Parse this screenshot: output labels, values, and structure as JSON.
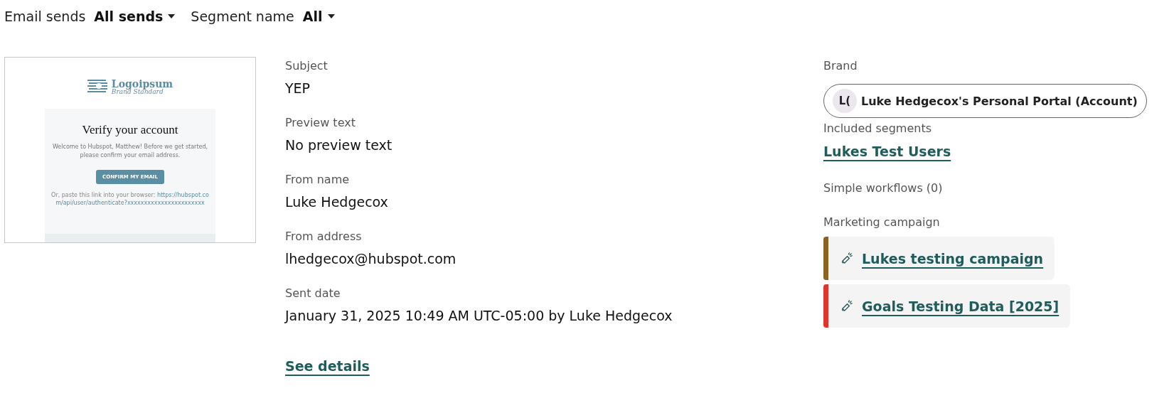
{
  "filters": [
    {
      "label": "Email sends",
      "value": "All sends"
    },
    {
      "label": "Segment name",
      "value": "All"
    }
  ],
  "preview": {
    "logo_name": "Logoipsum",
    "logo_tagline": "Brand Standard",
    "heading": "Verify your account",
    "body": "Welcome to Hubspot, Matthew! Before we get started, please confirm your email address.",
    "button": "CONFIRM MY EMAIL",
    "link_intro": "Or, paste this link into your browser:",
    "link": "https://hubspot.com/api/user/authenticate?xxxxxxxxxxxxxxxxxxxxxxx"
  },
  "details": [
    {
      "label": "Subject",
      "value": "YEP"
    },
    {
      "label": "Preview text",
      "value": "No preview text"
    },
    {
      "label": "From name",
      "value": "Luke Hedgecox"
    },
    {
      "label": "From address",
      "value": "lhedgecox@hubspot.com"
    },
    {
      "label": "Sent date",
      "value": "January 31, 2025 10:49 AM UTC-05:00 by Luke Hedgecox"
    }
  ],
  "see_details": "See details",
  "brand": {
    "label": "Brand",
    "initials": "L(",
    "name": "Luke Hedgecox's Personal Portal (Account)"
  },
  "segments": {
    "label": "Included segments",
    "items": [
      "Lukes Test Users"
    ]
  },
  "workflows": {
    "label": "Simple workflows (0)"
  },
  "campaigns": {
    "label": "Marketing campaign",
    "items": [
      {
        "name": "Lukes testing campaign",
        "color": "#8a6323"
      },
      {
        "name": "Goals Testing Data [2025]",
        "color": "#e0352b"
      }
    ]
  }
}
